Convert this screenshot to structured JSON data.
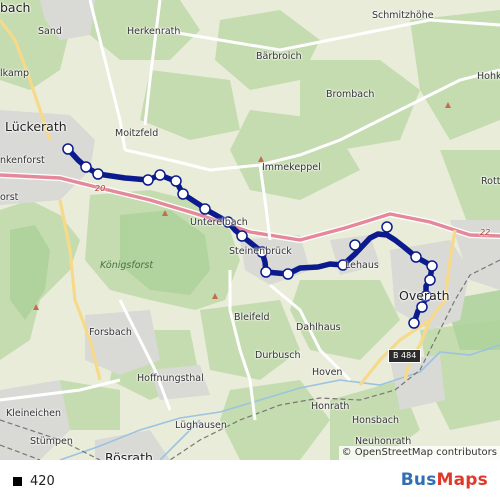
{
  "map": {
    "place_labels": [
      {
        "text": "bach",
        "big": true
      },
      {
        "text": "Sand"
      },
      {
        "text": "Herkenrath"
      },
      {
        "text": "Schmitzhöhe"
      },
      {
        "text": "Bärbroich"
      },
      {
        "text": "lkamp"
      },
      {
        "text": "Hohk"
      },
      {
        "text": "Brombach"
      },
      {
        "text": "Lückerath",
        "big": true
      },
      {
        "text": "Moitzfeld"
      },
      {
        "text": "nkenforst"
      },
      {
        "text": "Immekeppel"
      },
      {
        "text": "Rott"
      },
      {
        "text": "orst"
      },
      {
        "text": "Unterelbach"
      },
      {
        "text": "Steinenbrück"
      },
      {
        "text": "Lehaus"
      },
      {
        "text": "Overath",
        "big": true
      },
      {
        "text": "Königsforst",
        "forest": true
      },
      {
        "text": "Forsbach"
      },
      {
        "text": "Bleifeld"
      },
      {
        "text": "Dahlhaus"
      },
      {
        "text": "Durbusch"
      },
      {
        "text": "Hoffnungsthal"
      },
      {
        "text": "Hoven"
      },
      {
        "text": "Kleineichen"
      },
      {
        "text": "Lüghausen"
      },
      {
        "text": "Honrath"
      },
      {
        "text": "Honsbach"
      },
      {
        "text": "Stümpen"
      },
      {
        "text": "Neuhonrath"
      },
      {
        "text": "Rösrath",
        "big": true
      }
    ],
    "road_labels": {
      "a4_west": "20",
      "a4_east": "22",
      "b484": "B 484"
    },
    "route_color": "#0b1a8c",
    "stop_count": 22
  },
  "attribution": "© OpenStreetMap contributors",
  "legend": {
    "swatch_color": "#000000",
    "label": "420"
  },
  "brand": {
    "bus": "Bus",
    "maps": "Maps",
    "bus_color": "#2f6fb2",
    "maps_color": "#e0382b"
  }
}
